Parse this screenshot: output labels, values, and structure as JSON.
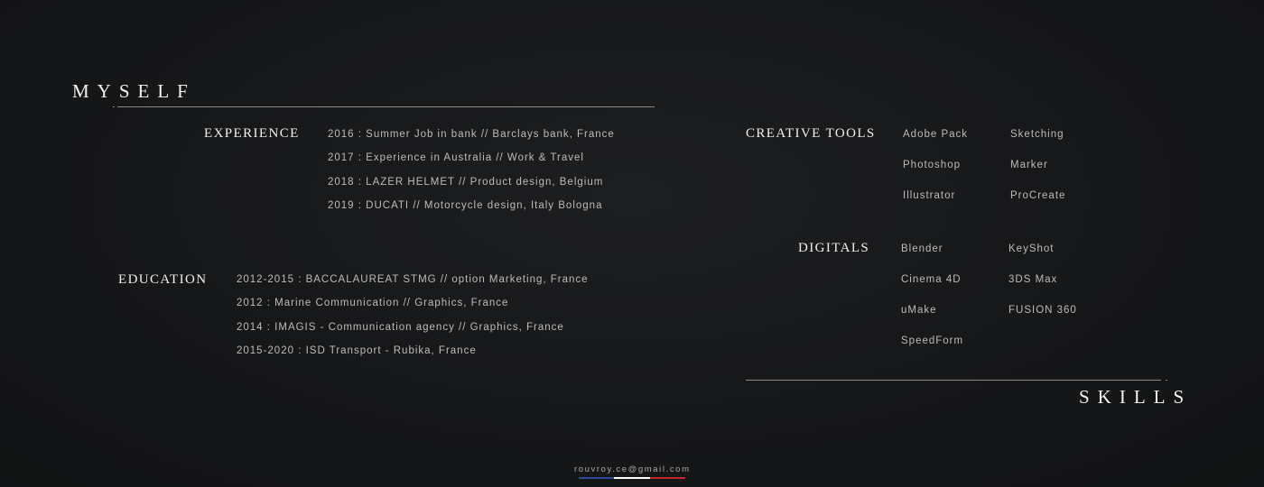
{
  "myself": {
    "title": "MYSELF",
    "experience": {
      "heading": "EXPERIENCE",
      "items": [
        "2016 : Summer Job in bank // Barclays bank, France",
        "2017 : Experience in Australia // Work & Travel",
        "2018 : LAZER HELMET // Product design, Belgium",
        "2019 : DUCATI // Motorcycle design, Italy Bologna"
      ]
    },
    "education": {
      "heading": "EDUCATION",
      "items": [
        "2012-2015 : BACCALAUREAT STMG // option Marketing, France",
        "2012 : Marine Communication // Graphics, France",
        "2014 : IMAGIS - Communication agency // Graphics, France",
        "2015-2020 : ISD Transport - Rubika, France"
      ]
    }
  },
  "skills": {
    "title": "SKILLS",
    "creative_tools": {
      "heading": "CREATIVE TOOLS",
      "col1": [
        "Adobe Pack",
        "Photoshop",
        "Illustrator"
      ],
      "col2": [
        "Sketching",
        "Marker",
        "ProCreate"
      ]
    },
    "digitals": {
      "heading": "DIGITALS",
      "col1": [
        "Blender",
        "Cinema 4D",
        "uMake",
        "SpeedForm"
      ],
      "col2": [
        "KeyShot",
        "3DS Max",
        "FUSION 360"
      ]
    }
  },
  "footer": {
    "email": "rouvroy.ce@gmail.com",
    "flag_colors": [
      "#2c4a9c",
      "#ffffff",
      "#c0282e"
    ]
  }
}
